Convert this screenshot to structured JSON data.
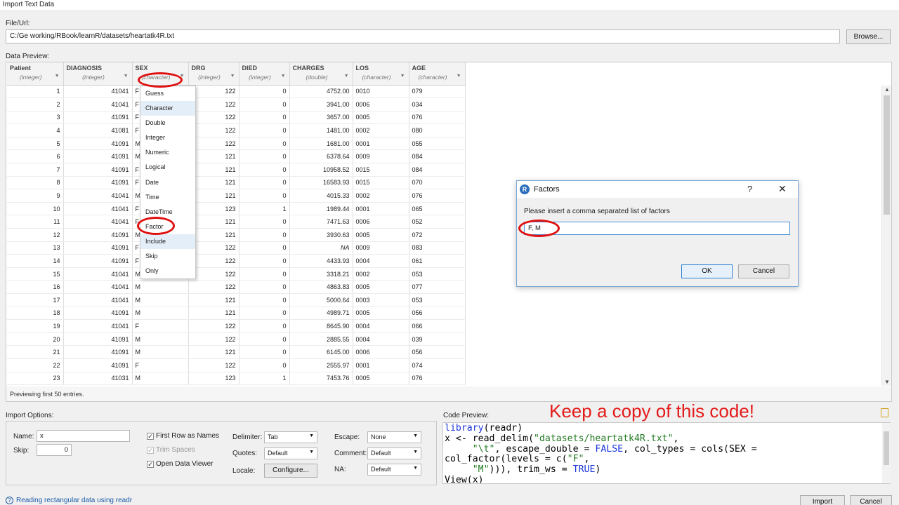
{
  "window": {
    "title": "Import Text Data"
  },
  "file": {
    "label": "File/Url:",
    "value": "C:/Ge working/RBook/learnR/datasets/heartatk4R.txt",
    "browse_label": "Browse..."
  },
  "preview": {
    "label": "Data Preview:",
    "status": "Previewing first 50 entries.",
    "columns": [
      {
        "name": "Patient",
        "type": "(integer)"
      },
      {
        "name": "DIAGNOSIS",
        "type": "(integer)"
      },
      {
        "name": "SEX",
        "type": "(character)"
      },
      {
        "name": "DRG",
        "type": "(integer)"
      },
      {
        "name": "DIED",
        "type": "(integer)"
      },
      {
        "name": "CHARGES",
        "type": "(double)"
      },
      {
        "name": "LOS",
        "type": "(character)"
      },
      {
        "name": "AGE",
        "type": "(character)"
      }
    ],
    "rows": [
      [
        "1",
        "41041",
        "F",
        "122",
        "0",
        "4752.00",
        "0010",
        "079"
      ],
      [
        "2",
        "41041",
        "F",
        "122",
        "0",
        "3941.00",
        "0006",
        "034"
      ],
      [
        "3",
        "41091",
        "F",
        "122",
        "0",
        "3657.00",
        "0005",
        "076"
      ],
      [
        "4",
        "41081",
        "F",
        "122",
        "0",
        "1481.00",
        "0002",
        "080"
      ],
      [
        "5",
        "41091",
        "M",
        "122",
        "0",
        "1681.00",
        "0001",
        "055"
      ],
      [
        "6",
        "41091",
        "M",
        "121",
        "0",
        "6378.64",
        "0009",
        "084"
      ],
      [
        "7",
        "41091",
        "F",
        "121",
        "0",
        "10958.52",
        "0015",
        "084"
      ],
      [
        "8",
        "41091",
        "F",
        "121",
        "0",
        "16583.93",
        "0015",
        "070"
      ],
      [
        "9",
        "41041",
        "M",
        "121",
        "0",
        "4015.33",
        "0002",
        "076"
      ],
      [
        "10",
        "41041",
        "F",
        "123",
        "1",
        "1989.44",
        "0001",
        "065"
      ],
      [
        "11",
        "41041",
        "F",
        "121",
        "0",
        "7471.63",
        "0006",
        "052"
      ],
      [
        "12",
        "41091",
        "M",
        "121",
        "0",
        "3930.63",
        "0005",
        "072"
      ],
      [
        "13",
        "41091",
        "F",
        "122",
        "0",
        "NA",
        "0009",
        "083"
      ],
      [
        "14",
        "41091",
        "F",
        "122",
        "0",
        "4433.93",
        "0004",
        "061"
      ],
      [
        "15",
        "41041",
        "M",
        "122",
        "0",
        "3318.21",
        "0002",
        "053"
      ],
      [
        "16",
        "41041",
        "M",
        "122",
        "0",
        "4863.83",
        "0005",
        "077"
      ],
      [
        "17",
        "41041",
        "M",
        "121",
        "0",
        "5000.64",
        "0003",
        "053"
      ],
      [
        "18",
        "41091",
        "M",
        "121",
        "0",
        "4989.71",
        "0005",
        "056"
      ],
      [
        "19",
        "41041",
        "F",
        "122",
        "0",
        "8645.90",
        "0004",
        "066"
      ],
      [
        "20",
        "41091",
        "M",
        "122",
        "0",
        "2885.55",
        "0004",
        "039"
      ],
      [
        "21",
        "41091",
        "M",
        "121",
        "0",
        "6145.00",
        "0006",
        "056"
      ],
      [
        "22",
        "41091",
        "F",
        "122",
        "0",
        "2555.97",
        "0001",
        "074"
      ],
      [
        "23",
        "41031",
        "M",
        "123",
        "1",
        "7453.76",
        "0005",
        "076"
      ]
    ]
  },
  "type_menu": {
    "items": [
      "Guess",
      "Character",
      "Double",
      "Integer",
      "Numeric",
      "Logical",
      "Date",
      "Time",
      "DateTime",
      "Factor",
      "Include",
      "Skip",
      "Only"
    ]
  },
  "factors_dialog": {
    "title": "Factors",
    "help_glyph": "?",
    "close_glyph": "✕",
    "prompt": "Please insert a comma separated list of factors",
    "value": "F, M",
    "ok_label": "OK",
    "cancel_label": "Cancel"
  },
  "import_options": {
    "label": "Import Options:",
    "name_label": "Name:",
    "name_value": "x",
    "skip_label": "Skip:",
    "skip_value": "0",
    "first_row_label": "First Row as Names",
    "trim_label": "Trim Spaces",
    "open_viewer_label": "Open Data Viewer",
    "delimiter_label": "Delimiter:",
    "delimiter_value": "Tab",
    "quotes_label": "Quotes:",
    "quotes_value": "Default",
    "locale_label": "Locale:",
    "configure_label": "Configure...",
    "escape_label": "Escape:",
    "escape_value": "None",
    "comment_label": "Comment:",
    "comment_value": "Default",
    "na_label": "NA:",
    "na_value": "Default"
  },
  "code_preview": {
    "label": "Code Preview:",
    "annotation": "Keep a copy of this code!"
  },
  "footer": {
    "help_link": "Reading rectangular data using readr",
    "import_label": "Import",
    "cancel_label": "Cancel"
  },
  "colors": {
    "highlight_circle": "#e01010",
    "annotation": "#e41a1a",
    "link": "#1a5aa8"
  }
}
